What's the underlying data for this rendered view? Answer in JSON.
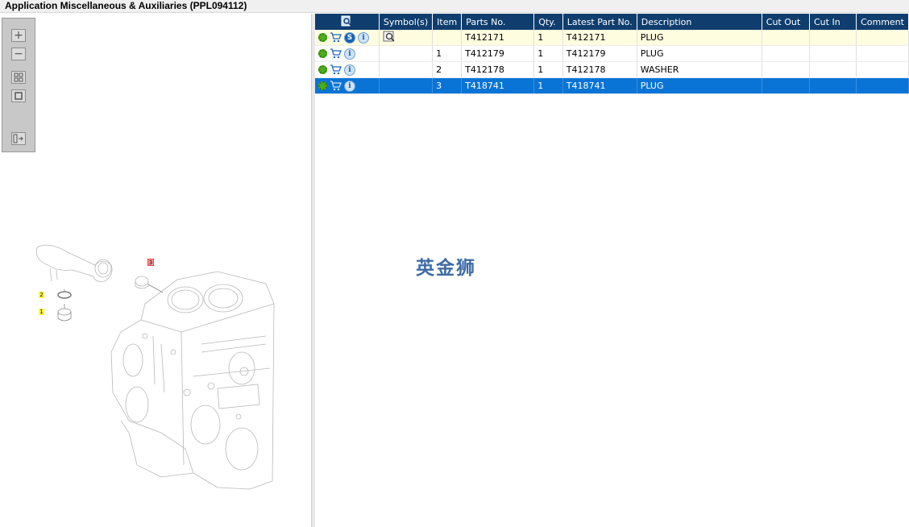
{
  "window": {
    "title": "Application Miscellaneous & Auxiliaries (PPL094112)"
  },
  "viewer_toolbar": {
    "zoom_in_icon": "plus-icon",
    "zoom_out_icon": "minus-icon",
    "fit_all_icon": "grid-icon",
    "fit_window_icon": "square-icon",
    "toggle_panel_icon": "panel-arrow-icon"
  },
  "drawing": {
    "callouts": [
      {
        "label": "1",
        "color": "#ffff33"
      },
      {
        "label": "2",
        "color": "#ffff33"
      },
      {
        "label": "3",
        "color": "#ff9999"
      }
    ]
  },
  "watermark": "英金狮",
  "parts_table": {
    "columns": [
      "",
      "Symbol(s)",
      "Item",
      "Parts No.",
      "Qty.",
      "Latest Part No.",
      "Description",
      "Cut Out",
      "Cut In",
      "Comment"
    ],
    "header_icon": "search-document-icon",
    "rows": [
      {
        "icons": [
          "gear-icon",
          "cart-icon",
          "s-icon",
          "info-icon"
        ],
        "symbol": "magnifier-doc-icon",
        "item": "",
        "part_no": "T412171",
        "qty": "1",
        "latest_part_no": "T412171",
        "description": "PLUG",
        "cut_out": "",
        "cut_in": "",
        "comment": "",
        "state": "highlighted"
      },
      {
        "icons": [
          "gear-icon",
          "cart-icon",
          "info-icon"
        ],
        "symbol": "",
        "item": "1",
        "part_no": "T412179",
        "qty": "1",
        "latest_part_no": "T412179",
        "description": "PLUG",
        "cut_out": "",
        "cut_in": "",
        "comment": "",
        "state": "normal"
      },
      {
        "icons": [
          "gear-icon",
          "cart-icon",
          "info-icon"
        ],
        "symbol": "",
        "item": "2",
        "part_no": "T412178",
        "qty": "1",
        "latest_part_no": "T412178",
        "description": "WASHER",
        "cut_out": "",
        "cut_in": "",
        "comment": "",
        "state": "normal"
      },
      {
        "icons": [
          "gear-icon",
          "cart-icon",
          "info-icon"
        ],
        "symbol": "",
        "item": "3",
        "part_no": "T418741",
        "qty": "1",
        "latest_part_no": "T418741",
        "description": "PLUG",
        "cut_out": "",
        "cut_in": "",
        "comment": "",
        "state": "selected"
      }
    ]
  },
  "colors": {
    "header_bg": "#0f3d6e",
    "selected_row": "#0a74d6",
    "highlight_row": "#fffde0"
  }
}
